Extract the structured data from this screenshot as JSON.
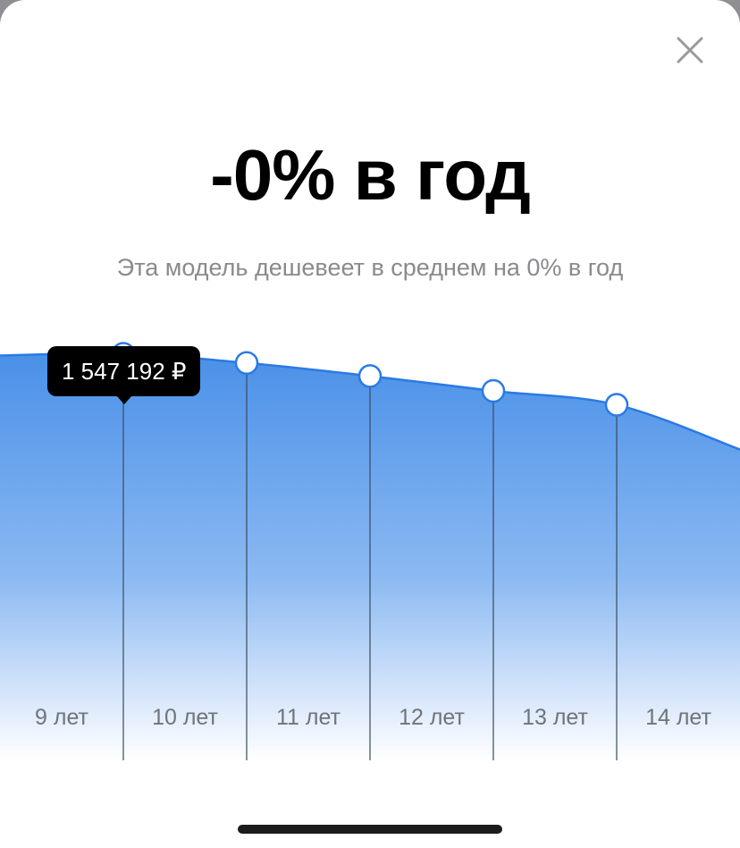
{
  "header": {
    "close_icon": "close-icon",
    "title": "-0% в год",
    "subtitle": "Эта модель дешевеет в среднем на 0% в год"
  },
  "tooltip": {
    "value": "1 547 192 ₽"
  },
  "chart_data": {
    "type": "area",
    "categories": [
      "9 лет",
      "10 лет",
      "11 лет",
      "12 лет",
      "13 лет",
      "14 лет"
    ],
    "marker_values": [
      1547192,
      1512000,
      1462000,
      1405000,
      1352000
    ],
    "selected_index": 1,
    "fill_color": "#4a90e8",
    "line_color": "#2a7ae4",
    "ylim": [
      0,
      1600000
    ],
    "grid": false
  }
}
